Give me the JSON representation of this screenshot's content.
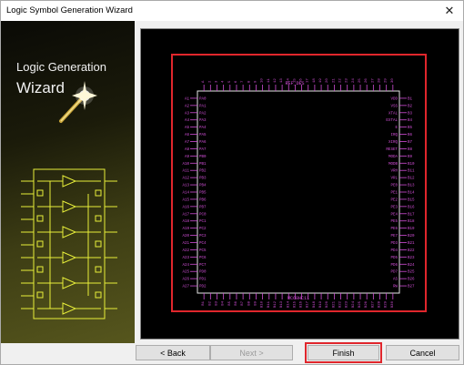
{
  "window": {
    "title": "Logic Symbol Generation Wizard",
    "close_glyph": "✕"
  },
  "side": {
    "line1": "Logic Generation",
    "line2": "Wizard"
  },
  "symbol": {
    "name": "MC68HC11",
    "ref": "REF_DES",
    "top_pins": [
      "A",
      "2",
      "3",
      "4",
      "5",
      "6",
      "7",
      "8",
      "9",
      "10",
      "11",
      "12",
      "13",
      "14",
      "15",
      "16",
      "17",
      "18",
      "19",
      "20",
      "21",
      "22",
      "23",
      "24",
      "25",
      "26",
      "27",
      "28",
      "29",
      "30"
    ],
    "bottom_pins": [
      "B1",
      "B2",
      "B3",
      "B4",
      "B5",
      "B6",
      "B7",
      "B8",
      "B9",
      "B10",
      "B11",
      "B12",
      "B13",
      "B14",
      "B15",
      "B16",
      "B17",
      "B18",
      "B19",
      "B20",
      "B21",
      "B22",
      "B23",
      "B24",
      "B25",
      "B26",
      "B27",
      "B28",
      "B29",
      "B30"
    ],
    "left_pins": [
      "A1",
      "A2",
      "A3",
      "A4",
      "A5",
      "A6",
      "A7",
      "A8",
      "A9",
      "A10",
      "A11",
      "A12",
      "A13",
      "A14",
      "A15",
      "A16",
      "A17",
      "A18",
      "A19",
      "A20",
      "A21",
      "A22",
      "A23",
      "A24",
      "A25",
      "A26",
      "A27"
    ],
    "left_labels": [
      "PA0",
      "PA1",
      "PA2",
      "PA3",
      "PA4",
      "PA5",
      "PA6",
      "PA7",
      "PB0",
      "PB1",
      "PB2",
      "PB3",
      "PB4",
      "PB5",
      "PB6",
      "PB7",
      "PC0",
      "PC1",
      "PC2",
      "PC3",
      "PC4",
      "PC5",
      "PC6",
      "PC7",
      "PD0",
      "PD1",
      "PD2"
    ],
    "right_pins": [
      "B1",
      "B2",
      "B3",
      "B4",
      "B5",
      "B6",
      "B7",
      "B8",
      "B9",
      "B10",
      "B11",
      "B12",
      "B13",
      "B14",
      "B15",
      "B16",
      "B17",
      "B18",
      "B19",
      "B20",
      "B21",
      "B22",
      "B23",
      "B24",
      "B25",
      "B26",
      "B27"
    ],
    "right_labels": [
      "VDD",
      "VSS",
      "XTAL",
      "EXTAL",
      "E",
      "IRQ",
      "XIRQ",
      "RESET",
      "MODA",
      "MODB",
      "VRH",
      "VRL",
      "PE0",
      "PE1",
      "PE2",
      "PE3",
      "PE4",
      "PE5",
      "PE6",
      "PE7",
      "PD3",
      "PD4",
      "PD5",
      "PD6",
      "PD7",
      "AS",
      "RW"
    ],
    "colors": {
      "pin": "#d24fd8",
      "body": "#e6e6e6",
      "frame": "#e0262c"
    }
  },
  "buttons": {
    "back": "< Back",
    "next": "Next >",
    "finish": "Finish",
    "cancel": "Cancel"
  }
}
